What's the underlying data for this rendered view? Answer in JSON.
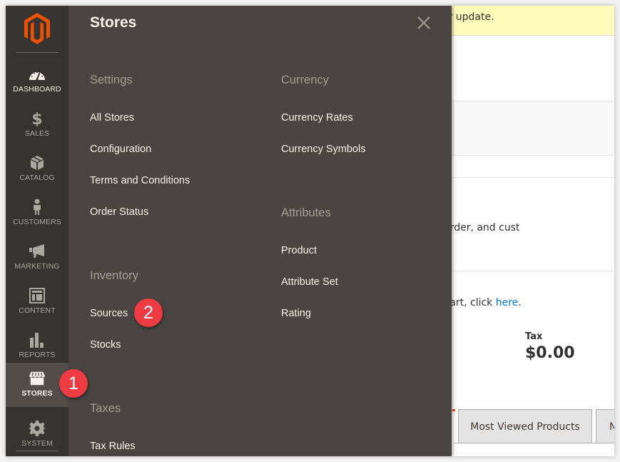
{
  "colors": {
    "nav_bg": "#373330",
    "flyout_bg": "#4a4542",
    "brand": "#eb5202",
    "badge": "#ee3b44",
    "link": "#007bdb",
    "notice_bg": "#fffbbb"
  },
  "nav": {
    "logo_icon": "magento-logo-icon",
    "items": [
      {
        "label": "DASHBOARD",
        "icon": "dashboard-gauge-icon"
      },
      {
        "label": "SALES",
        "icon": "dollar-icon"
      },
      {
        "label": "CATALOG",
        "icon": "box-icon"
      },
      {
        "label": "CUSTOMERS",
        "icon": "person-icon"
      },
      {
        "label": "MARKETING",
        "icon": "megaphone-icon"
      },
      {
        "label": "CONTENT",
        "icon": "layout-icon"
      },
      {
        "label": "REPORTS",
        "icon": "bar-chart-icon"
      },
      {
        "label": "STORES",
        "icon": "storefront-icon",
        "active": true
      },
      {
        "label": "SYSTEM",
        "icon": "gear-icon"
      }
    ]
  },
  "flyout": {
    "title": "Stores",
    "close_icon": "close-icon",
    "left_column": [
      {
        "title": "Settings",
        "links": [
          "All Stores",
          "Configuration",
          "Terms and Conditions",
          "Order Status"
        ]
      },
      {
        "title": "Inventory",
        "links": [
          "Sources",
          "Stocks"
        ]
      },
      {
        "title": "Taxes",
        "links": [
          "Tax Rules"
        ]
      }
    ],
    "right_column": [
      {
        "title": "Currency",
        "links": [
          "Currency Rates",
          "Currency Symbols"
        ]
      },
      {
        "title": "Attributes",
        "links": [
          "Product",
          "Attribute Set",
          "Rating"
        ]
      }
    ]
  },
  "background_page": {
    "notice": "One or more indexers are invalid. Make sure your Magento cron job is running. One or more indexers are scheduled for update.",
    "notice_visible": "heduled for update.",
    "intro_visible": "ur dynamic product, order, and cust",
    "chart_text_visible": "bled. To enable the chart, click ",
    "chart_link": "here",
    "chart_text_end": ".",
    "tax_label": "Tax",
    "tax_value": "$0.00",
    "tabs": [
      "Most Viewed Products",
      "N"
    ]
  },
  "callouts": [
    {
      "number": "1",
      "target": "STORES"
    },
    {
      "number": "2",
      "target": "Sources"
    }
  ]
}
